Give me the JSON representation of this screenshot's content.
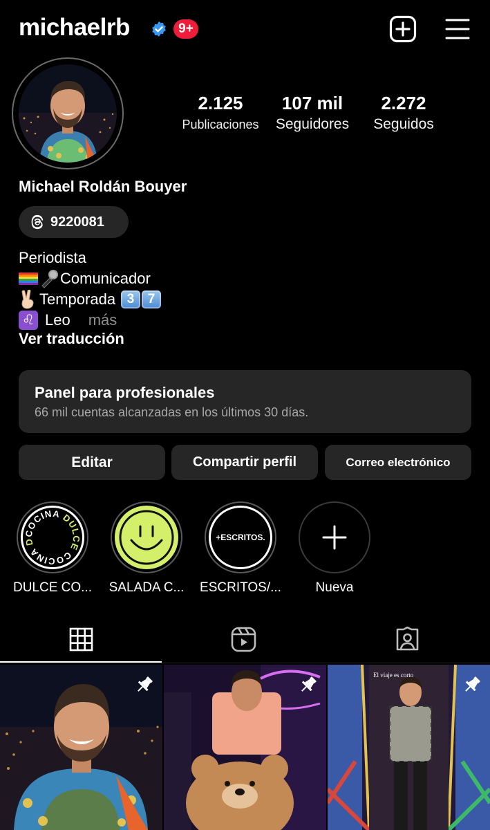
{
  "header": {
    "username": "michaelrb",
    "notification_badge": "9+",
    "verified": true
  },
  "profile": {
    "full_name": "Michael Roldán Bouyer",
    "threads_label": "9220081",
    "stats": [
      {
        "value": "2.125",
        "label": "Publicaciones"
      },
      {
        "value": "107 mil",
        "label": "Seguidores"
      },
      {
        "value": "2.272",
        "label": "Seguidos"
      }
    ],
    "bio": {
      "line1": "Periodista",
      "line2_text": "Comunicador",
      "line3_text": "Temporada",
      "line3_keycaps": [
        "3",
        "7"
      ],
      "line4_text": "Leo",
      "more": "más"
    },
    "translate": "Ver traducción"
  },
  "panel": {
    "title": "Panel para profesionales",
    "subtitle": "66 mil cuentas alcanzadas en los últimos 30 días."
  },
  "buttons": {
    "edit": "Editar",
    "share": "Compartir perfil",
    "email": "Correo electrónico"
  },
  "highlights": [
    {
      "label": "DULCE CO...",
      "cover_text": "COCINA DULCE"
    },
    {
      "label": "SALADA C...",
      "cover_color": "#d4ef6a"
    },
    {
      "label": "ESCRITOS/...",
      "cover_text": "+ESCRITOS."
    },
    {
      "label": "Nueva"
    }
  ],
  "tabs": [
    "grid-icon",
    "reels-icon",
    "tagged-icon"
  ],
  "colors": {
    "background": "#000000",
    "surface": "#262626",
    "badge_red": "#ee1d3a",
    "verified_blue": "#3897f0",
    "muted_text": "#8e8e8e"
  }
}
